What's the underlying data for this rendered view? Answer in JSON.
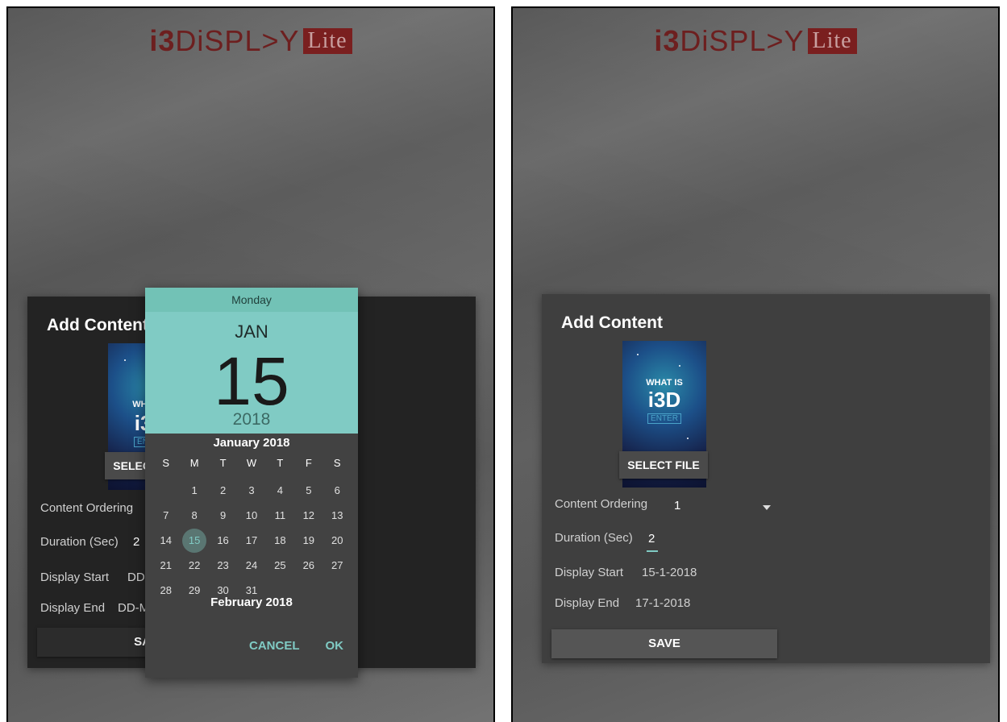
{
  "logo": {
    "part1": "i3",
    "part2": "DiSPL",
    "arrow": ">",
    "part3": "Y",
    "lite": "Lite"
  },
  "left": {
    "dialog": {
      "title": "Add Content",
      "thumb_what": "WHAT IS",
      "thumb_i3d": "i3D",
      "thumb_enter": "ENTER",
      "select_file": "SELECT FILE",
      "content_ordering_label": "Content Ordering",
      "duration_label": "Duration (Sec)",
      "duration_value": "2",
      "display_start_label": "Display Start",
      "display_start_value": "DD-M",
      "display_end_label": "Display End",
      "display_end_value": "DD-M",
      "save": "SAVE"
    },
    "datepicker": {
      "weekday": "Monday",
      "month": "JAN",
      "day": "15",
      "year": "2018",
      "calendar_title": "January 2018",
      "weekdays": [
        "S",
        "M",
        "T",
        "W",
        "T",
        "F",
        "S"
      ],
      "weeks": [
        [
          "",
          "1",
          "2",
          "3",
          "4",
          "5",
          "6"
        ],
        [
          "7",
          "8",
          "9",
          "10",
          "11",
          "12",
          "13"
        ],
        [
          "14",
          "15",
          "16",
          "17",
          "18",
          "19",
          "20"
        ],
        [
          "21",
          "22",
          "23",
          "24",
          "25",
          "26",
          "27"
        ],
        [
          "28",
          "29",
          "30",
          "31",
          "",
          "",
          ""
        ]
      ],
      "selected_day": "15",
      "next_month_title": "February 2018",
      "cancel": "CANCEL",
      "ok": "OK"
    }
  },
  "right": {
    "dialog": {
      "title": "Add Content",
      "thumb_what": "WHAT IS",
      "thumb_i3d": "i3D",
      "thumb_enter": "ENTER",
      "select_file": "SELECT FILE",
      "content_ordering_label": "Content Ordering",
      "content_ordering_value": "1",
      "duration_label": "Duration (Sec)",
      "duration_value": "2",
      "display_start_label": "Display Start",
      "display_start_value": "15-1-2018",
      "display_end_label": "Display End",
      "display_end_value": "17-1-2018",
      "save": "SAVE"
    }
  },
  "colors": {
    "accent": "#80cbc4",
    "logo": "#6d1f1f"
  }
}
